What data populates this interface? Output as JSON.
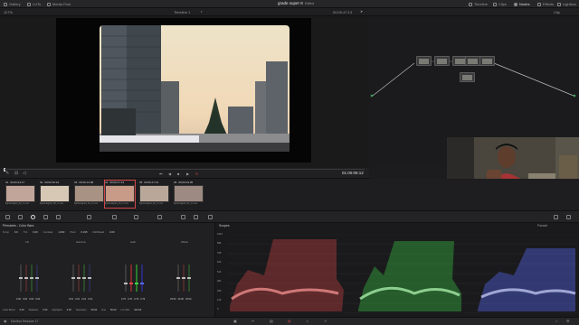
{
  "topbar": {
    "left_buttons": [
      "Gallery",
      "LUTs",
      "Media Pool"
    ],
    "project_title": "grade super 8",
    "project_status": "Edited",
    "right_buttons": [
      "Timeline",
      "Clips",
      "Nodes",
      "Effects",
      "Lightbox"
    ]
  },
  "subbar": {
    "zoom": "117%",
    "timeline_name": "Timeline 1",
    "timecode": "00:00:47:13",
    "clip_mode": "Clip"
  },
  "transport": {
    "timecode": "01:00:06:12"
  },
  "thumbnails": [
    {
      "index": "01",
      "timecode": "00:00:24:17",
      "name": "lightandgold_02_C.mov",
      "color": "#c2a59a"
    },
    {
      "index": "02",
      "timecode": "00:00:36:01",
      "name": "lightandgold_08_C.mov",
      "color": "#d7c8b6"
    },
    {
      "index": "03",
      "timecode": "00:00:13:08",
      "name": "lightandgold_16_C.mov",
      "color": "#a89283"
    },
    {
      "index": "04",
      "timecode": "00:00:47:13",
      "name": "lightandgold_19_C.mov",
      "color": "#c89a88"
    },
    {
      "index": "05",
      "timecode": "00:00:47:13",
      "name": "lightandgold_22_C.mov",
      "color": "#b9a89a"
    },
    {
      "index": "06",
      "timecode": "00:00:03:05",
      "name": "lightandgold_31_C.mov",
      "color": "#9d8a82"
    }
  ],
  "primaries": {
    "title": "Primaries - Color Bars",
    "top_labels": [
      "Temp",
      "0.0",
      "Tint",
      "0.00",
      "Contrast",
      "1.000",
      "Pivot",
      "0.435",
      "Mid/Detail",
      "0.00"
    ],
    "wheels": [
      {
        "name": "Lift",
        "values": [
          "0.00",
          "0.00",
          "0.00",
          "0.00"
        ]
      },
      {
        "name": "Gamma",
        "values": [
          "0.01",
          "0.01",
          "0.01",
          "0.01"
        ]
      },
      {
        "name": "Gain",
        "values": [
          "0.76",
          "0.76",
          "0.76",
          "0.76"
        ]
      },
      {
        "name": "Offset",
        "values": [
          "25.00",
          "25.00",
          "25.00"
        ]
      }
    ],
    "bottom_labels": [
      "Color Boost",
      "0.00",
      "Shadows",
      "0.00",
      "Highlights",
      "0.00",
      "Saturation",
      "50.00",
      "Hue",
      "50.00",
      "Lum Mix",
      "100.00"
    ]
  },
  "scopes": {
    "title": "Scopes",
    "mode": "Parade",
    "scale": [
      "1023",
      "896",
      "768",
      "640",
      "512",
      "384",
      "256",
      "128",
      "0"
    ]
  },
  "bottombar": {
    "app_name": "DaVinci Resolve 17"
  },
  "colors": {
    "accent": "#d0464a",
    "red_parade": "#e04848",
    "green_parade": "#3fd64a",
    "blue_parade": "#5a6bff"
  }
}
